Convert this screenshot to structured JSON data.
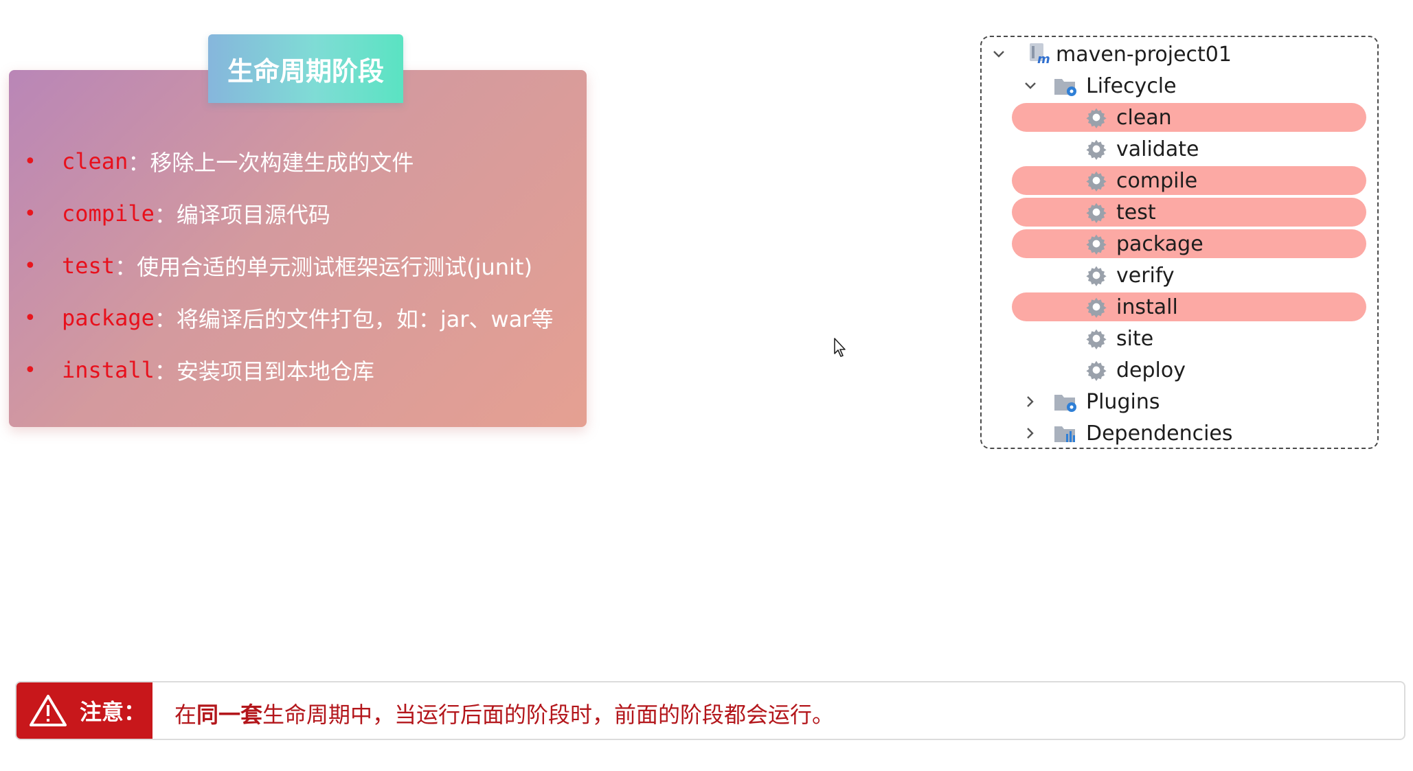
{
  "lifecycle_card": {
    "title": "生命周期阶段",
    "items": [
      {
        "bullet": "•",
        "keyword": "clean",
        "sep": "：",
        "desc": "移除上一次构建生成的文件"
      },
      {
        "bullet": "•",
        "keyword": "compile",
        "sep": "：",
        "desc": "编译项目源代码"
      },
      {
        "bullet": "•",
        "keyword": "test",
        "sep": "：",
        "desc": "使用合适的单元测试框架运行测试(junit)"
      },
      {
        "bullet": "•",
        "keyword": "package",
        "sep": "：",
        "desc": "将编译后的文件打包，如：jar、war等"
      },
      {
        "bullet": "•",
        "keyword": "install",
        "sep": "：",
        "desc": "安装项目到本地仓库"
      }
    ]
  },
  "maven_tree": {
    "project": "maven-project01",
    "lifecycle_label": "Lifecycle",
    "phases": [
      {
        "label": "clean",
        "highlighted": true
      },
      {
        "label": "validate",
        "highlighted": false
      },
      {
        "label": "compile",
        "highlighted": true
      },
      {
        "label": "test",
        "highlighted": true
      },
      {
        "label": "package",
        "highlighted": true
      },
      {
        "label": "verify",
        "highlighted": false
      },
      {
        "label": "install",
        "highlighted": true
      },
      {
        "label": "site",
        "highlighted": false
      },
      {
        "label": "deploy",
        "highlighted": false
      }
    ],
    "plugins_label": "Plugins",
    "dependencies_label": "Dependencies",
    "icons": {
      "project": "maven-module-icon",
      "lifecycle": "lifecycle-folder-icon",
      "phase": "gear-icon",
      "plugins": "plugins-folder-icon",
      "dependencies": "dependencies-folder-icon"
    },
    "highlight_color": "#fca9a4"
  },
  "notice": {
    "title": "注意：",
    "text_prefix": "在",
    "text_bold": "同一套",
    "text_suffix": "生命周期中，当运行后面的阶段时，前面的阶段都会运行。",
    "accent_color": "#c8171b"
  }
}
